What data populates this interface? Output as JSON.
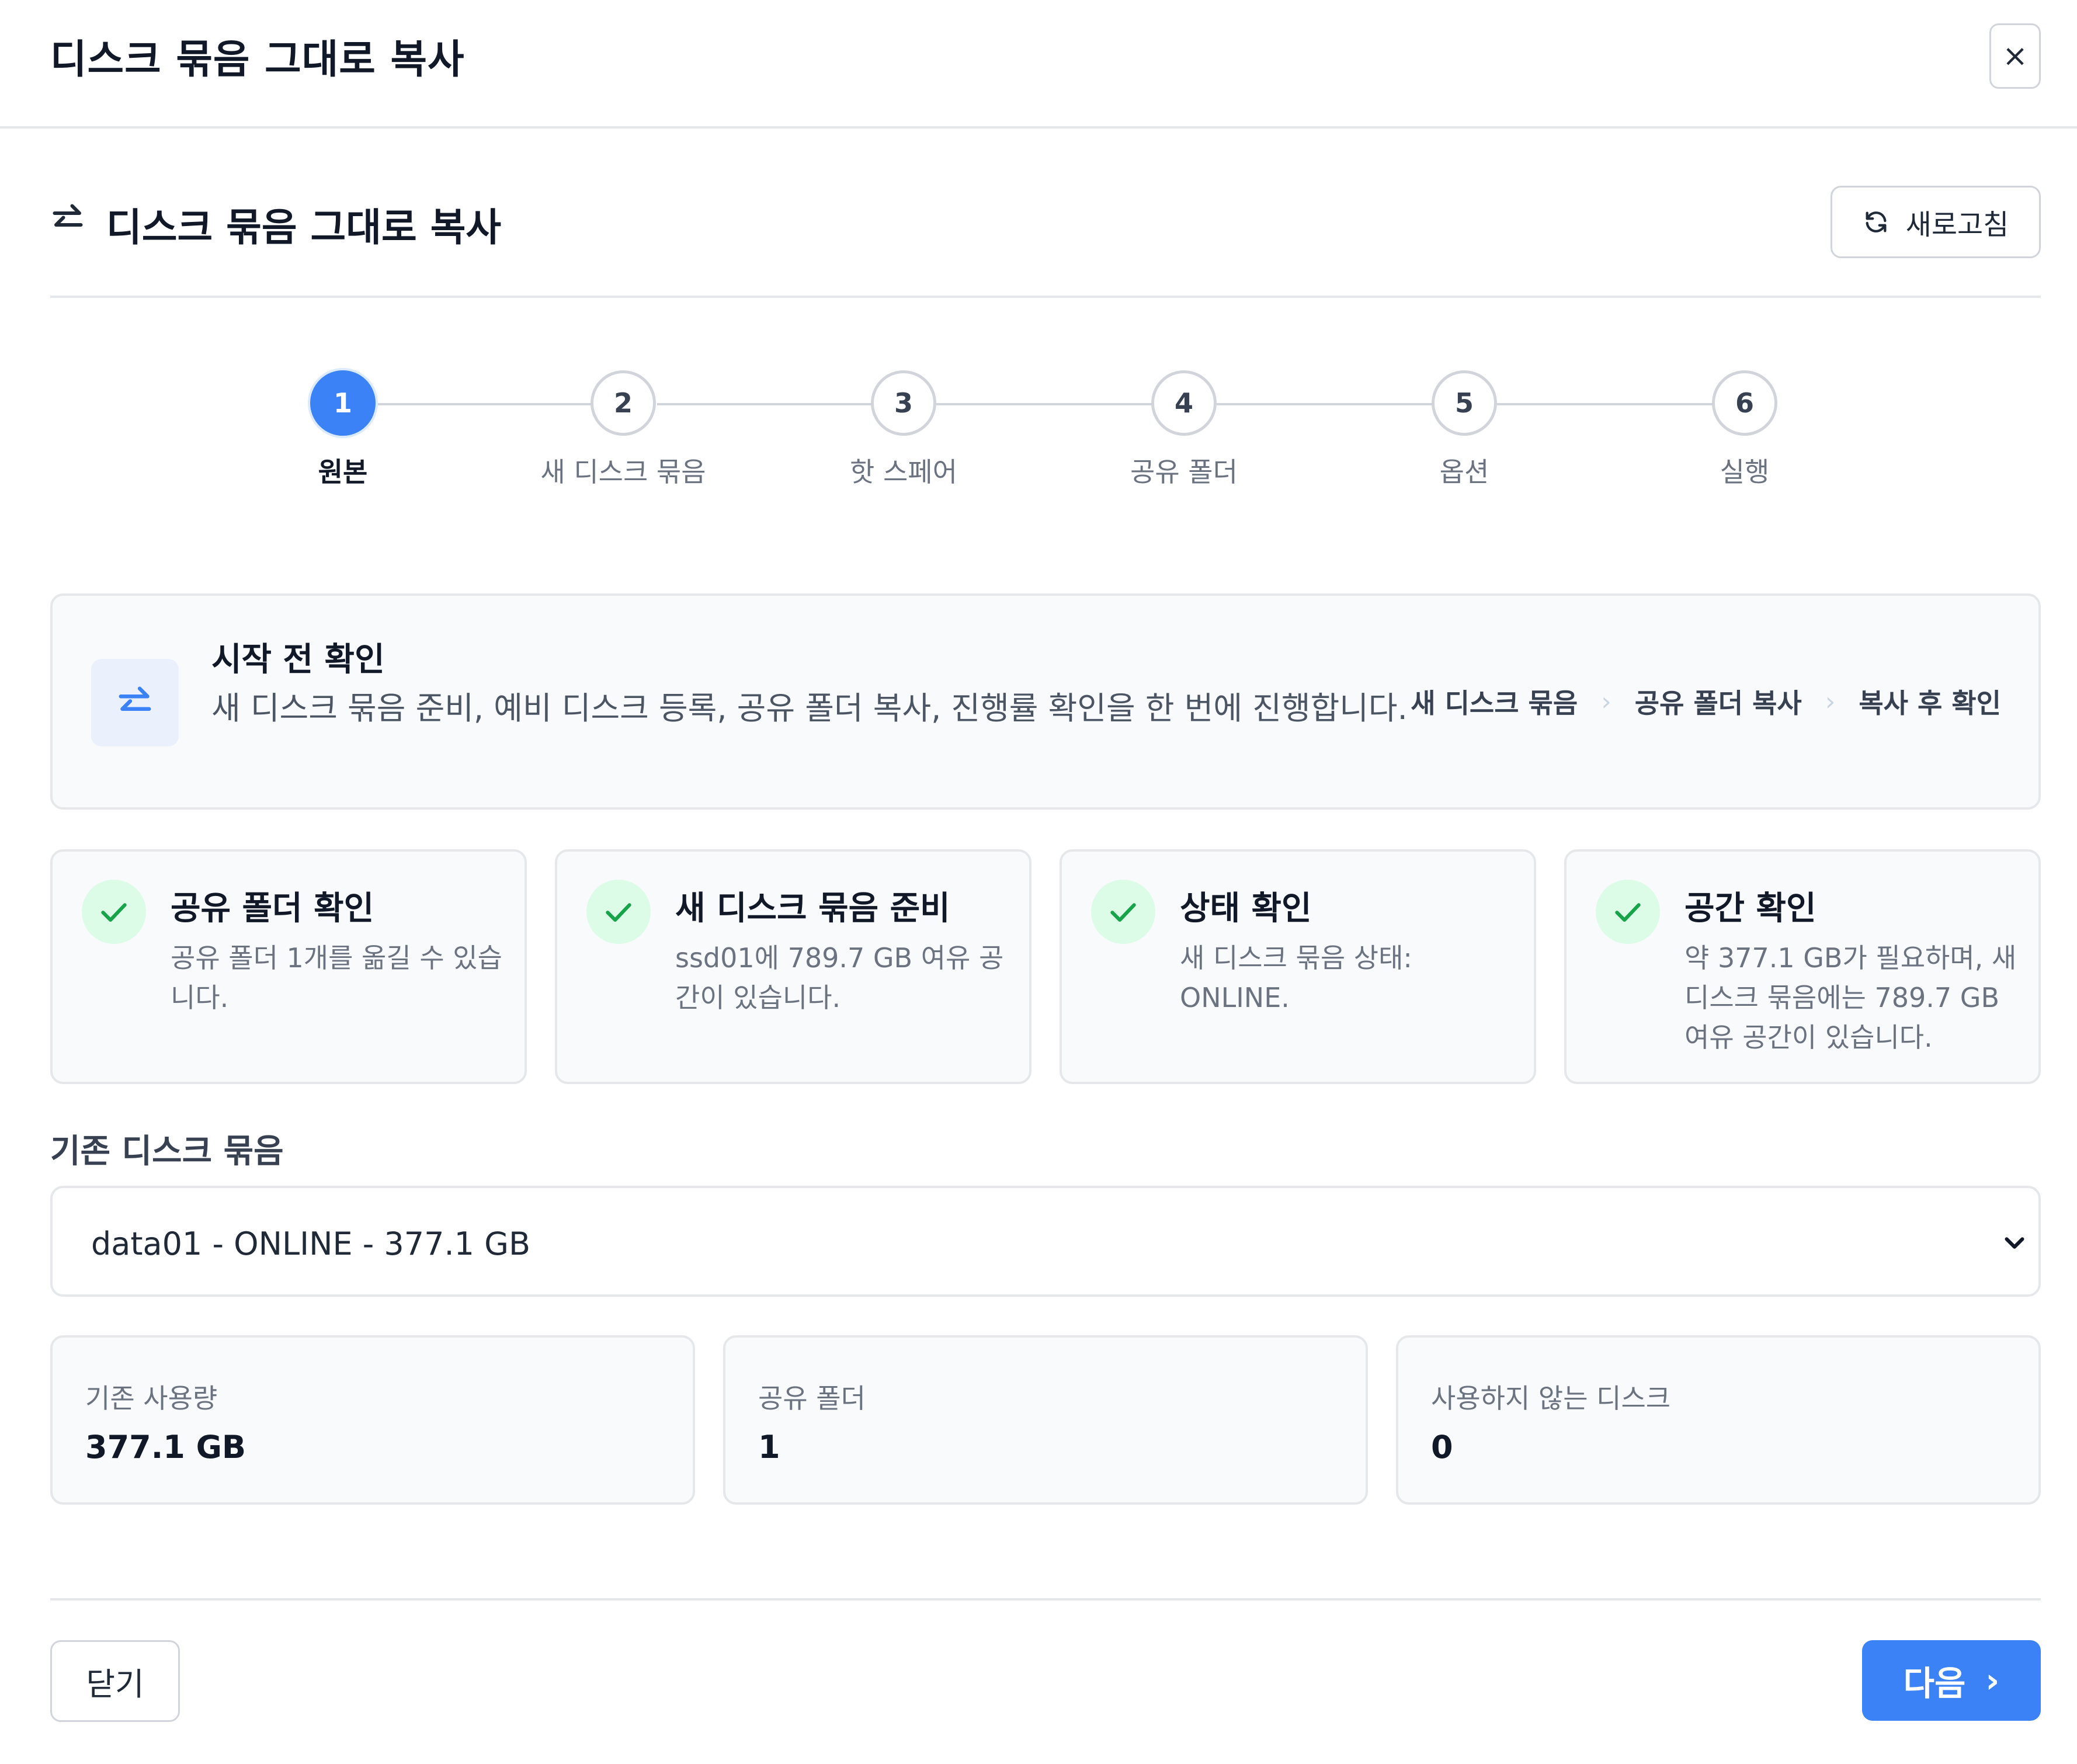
{
  "dialog": {
    "title": "디스크 묶음 그대로 복사",
    "close_glyph": "×"
  },
  "section": {
    "title": "디스크 묶음 그대로 복사",
    "icon": "swap-arrows-icon",
    "refresh_label": "새로고침"
  },
  "stepper": {
    "active_step": 1,
    "steps": [
      {
        "number": "1",
        "label": "원본"
      },
      {
        "number": "2",
        "label": "새 디스크 묶음"
      },
      {
        "number": "3",
        "label": "핫 스페어"
      },
      {
        "number": "4",
        "label": "공유 폴더"
      },
      {
        "number": "5",
        "label": "옵션"
      },
      {
        "number": "6",
        "label": "실행"
      }
    ]
  },
  "info": {
    "title": "시작 전 확인",
    "description": "새 디스크 묶음 준비, 예비 디스크 등록, 공유 폴더 복사, 진행률 확인을 한 번에 진행합니다.",
    "flow": [
      "새 디스크 묶음",
      "공유 폴더 복사",
      "복사 후 확인"
    ],
    "flow_separator": "›"
  },
  "checks": [
    {
      "title": "공유 폴더 확인",
      "description": "공유 폴더 1개를 옮길 수 있습니다."
    },
    {
      "title": "새 디스크 묶음 준비",
      "description": "ssd01에 789.7 GB 여유 공간이 있습니다."
    },
    {
      "title": "상태 확인",
      "description": "새 디스크 묶음 상태: ONLINE."
    },
    {
      "title": "공간 확인",
      "description": "약 377.1 GB가 필요하며, 새 디스크 묶음에는 789.7 GB 여유 공간이 있습니다."
    }
  ],
  "source_pool": {
    "label": "기존 디스크 묶음",
    "selected": "data01 - ONLINE - 377.1 GB"
  },
  "stats": [
    {
      "label": "기존 사용량",
      "value": "377.1 GB"
    },
    {
      "label": "공유 폴더",
      "value": "1"
    },
    {
      "label": "사용하지 않는 디스크",
      "value": "0"
    }
  ],
  "footer": {
    "close_label": "닫기",
    "next_label": "다음",
    "next_glyph": "›"
  },
  "colors": {
    "accent": "#3b82f6",
    "success": "#16a34a",
    "success_bg": "#dcfce7",
    "border": "#e5e7eb",
    "card_bg": "#f8fafc"
  }
}
